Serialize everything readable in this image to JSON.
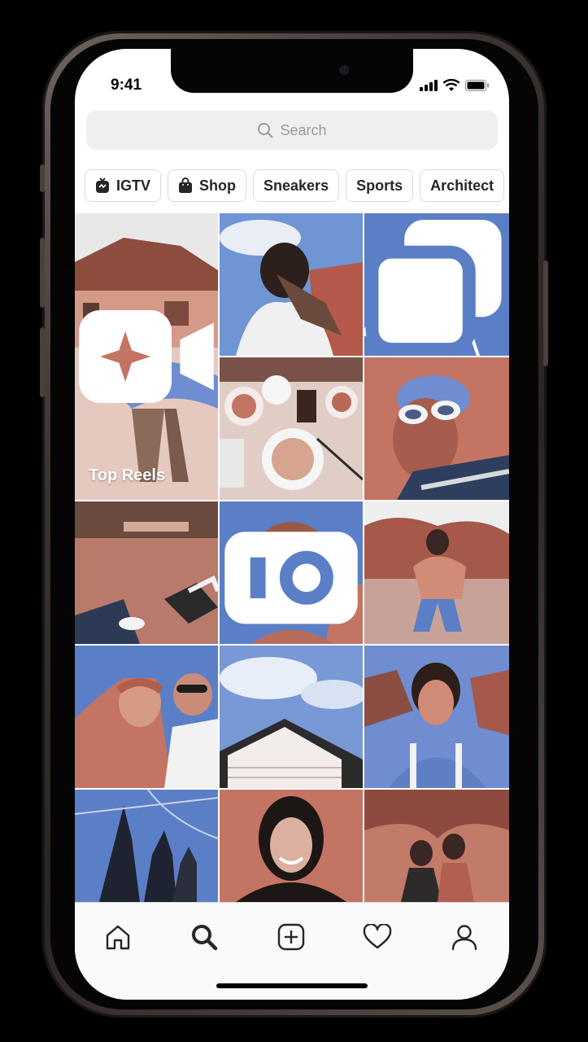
{
  "status": {
    "time": "9:41"
  },
  "search": {
    "placeholder": "Search",
    "icon": "search-icon"
  },
  "chips": [
    {
      "label": "IGTV",
      "icon": "igtv-icon"
    },
    {
      "label": "Shop",
      "icon": "shopping-bag-icon"
    },
    {
      "label": "Sneakers",
      "icon": ""
    },
    {
      "label": "Sports",
      "icon": ""
    },
    {
      "label": "Architect",
      "icon": ""
    }
  ],
  "grid": {
    "reel_label": "Top Reels",
    "reel_icon": "reels-icon",
    "tiles": [
      {
        "name": "tile-soccer-reel",
        "desc": "person juggling soccer ball",
        "badge": "reels"
      },
      {
        "name": "tile-man-selfie",
        "badge": ""
      },
      {
        "name": "tile-basketball-hoop",
        "badge": "carousel"
      },
      {
        "name": "tile-food-table",
        "badge": ""
      },
      {
        "name": "tile-sunglasses",
        "badge": ""
      },
      {
        "name": "tile-feet-grass",
        "badge": ""
      },
      {
        "name": "tile-smiling-face",
        "badge": "igtv"
      },
      {
        "name": "tile-piggyback",
        "badge": ""
      },
      {
        "name": "tile-friends-selfie",
        "badge": ""
      },
      {
        "name": "tile-house-sky",
        "badge": ""
      },
      {
        "name": "tile-woman-portrait",
        "badge": ""
      },
      {
        "name": "tile-shadows",
        "badge": ""
      },
      {
        "name": "tile-hijab-woman",
        "badge": ""
      },
      {
        "name": "tile-two-women-trees",
        "badge": ""
      }
    ]
  },
  "tabbar": [
    {
      "name": "home",
      "icon": "home-icon"
    },
    {
      "name": "search",
      "icon": "search-icon",
      "active": true
    },
    {
      "name": "create",
      "icon": "add-post-icon"
    },
    {
      "name": "activity",
      "icon": "heart-icon"
    },
    {
      "name": "profile",
      "icon": "profile-icon"
    }
  ],
  "colors": {
    "blue": "#5b7fc6",
    "salmon": "#c47462",
    "text": "#262626",
    "muted": "#9a9a9a"
  }
}
